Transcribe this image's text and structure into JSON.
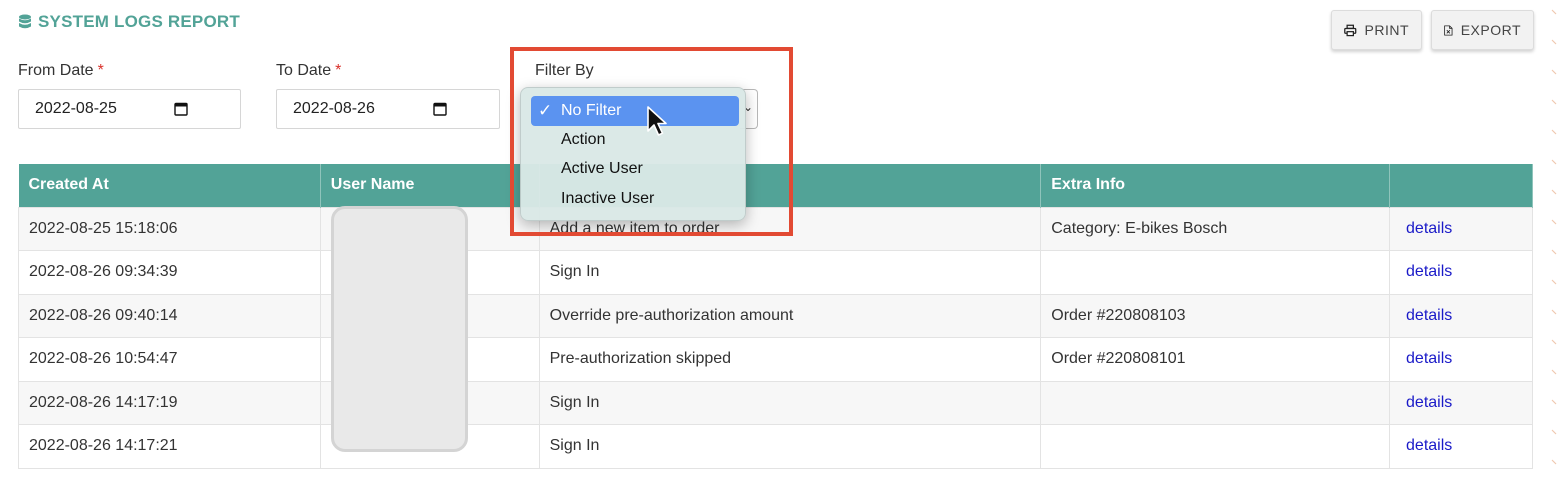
{
  "page": {
    "title": "SYSTEM LOGS REPORT",
    "title_icon": "database-icon"
  },
  "toolbar": {
    "print_label": "PRINT",
    "export_label": "EXPORT"
  },
  "filters": {
    "from_label": "From Date",
    "from_required": "*",
    "from_value": "2022-08-25",
    "to_label": "To Date",
    "to_required": "*",
    "to_value": "2022-08-26",
    "filter_label": "Filter By",
    "filter_selected": "No Filter",
    "filter_options": [
      "No Filter",
      "Action",
      "Active User",
      "Inactive User"
    ]
  },
  "table": {
    "headers": [
      "Created At",
      "User Name",
      "",
      "Extra Info",
      ""
    ],
    "rows": [
      {
        "created_at": "2022-08-25 15:18:06",
        "action": "Add a new item to order",
        "extra": "Category: E-bikes Bosch",
        "link": "details"
      },
      {
        "created_at": "2022-08-26 09:34:39",
        "action": "Sign In",
        "extra": "",
        "link": "details"
      },
      {
        "created_at": "2022-08-26 09:40:14",
        "action": "Override pre-authorization amount",
        "extra": "Order #220808103",
        "link": "details"
      },
      {
        "created_at": "2022-08-26 10:54:47",
        "action": "Pre-authorization skipped",
        "extra": "Order #220808101",
        "link": "details"
      },
      {
        "created_at": "2022-08-26 14:17:19",
        "action": "Sign In",
        "extra": "",
        "link": "details"
      },
      {
        "created_at": "2022-08-26 14:17:21",
        "action": "Sign In",
        "extra": "",
        "link": "details"
      }
    ]
  },
  "colors": {
    "accent": "#52a397",
    "selection": "#5b93f0",
    "highlight": "#e24a33",
    "link": "#1a1ac8"
  }
}
